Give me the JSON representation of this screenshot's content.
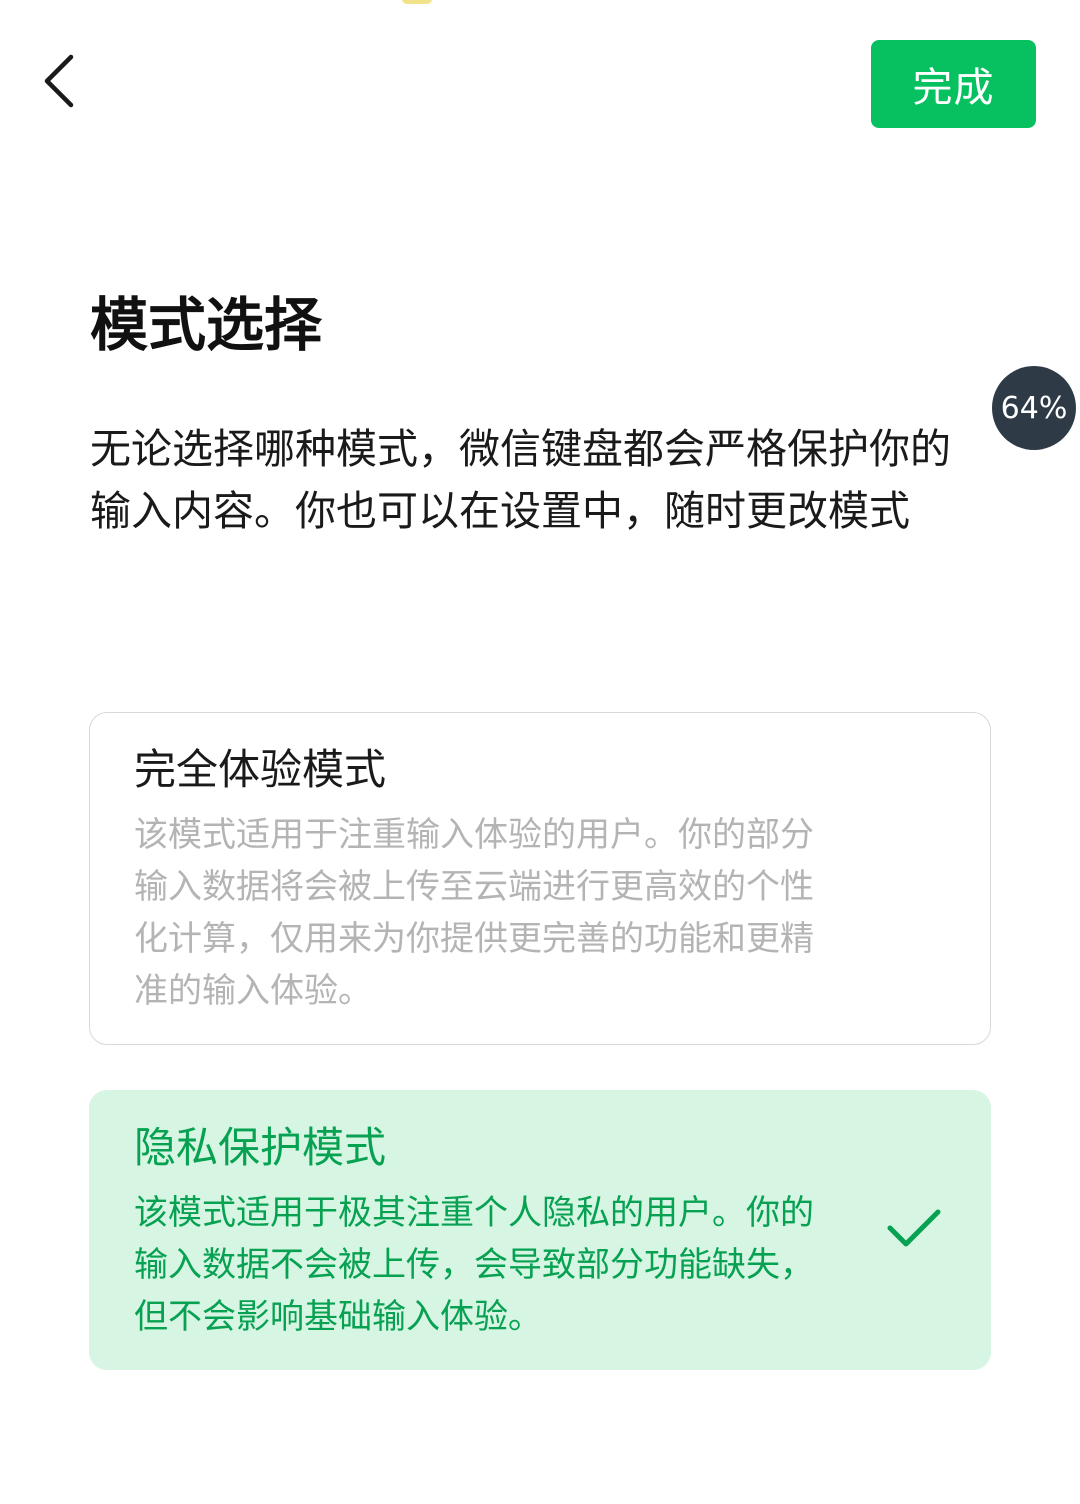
{
  "header": {
    "back_icon": "chevron-left-icon",
    "done_label": "完成"
  },
  "progress_badge": {
    "label": "64%",
    "value": 0.64
  },
  "page": {
    "title": "模式选择",
    "intro": "无论选择哪种模式，微信键盘都会严格保护你的输入内容。你也可以在设置中，随时更改模式"
  },
  "modes": [
    {
      "title": "完全体验模式",
      "description": "该模式适用于注重输入体验的用户。你的部分输入数据将会被上传至云端进行更高效的个性化计算，仅用来为你提供更完善的功能和更精准的输入体验。",
      "selected": false
    },
    {
      "title": "隐私保护模式",
      "description": "该模式适用于极其注重个人隐私的用户。你的输入数据不会被上传，会导致部分功能缺失，但不会影响基础输入体验。",
      "selected": true,
      "check_icon": "checkmark-icon"
    }
  ],
  "colors": {
    "accent": "#07c160",
    "accent_text": "#07a152",
    "selected_bg": "#d7f5e3",
    "badge_bg": "#2f3a47",
    "muted_text": "#b4b4b4"
  }
}
